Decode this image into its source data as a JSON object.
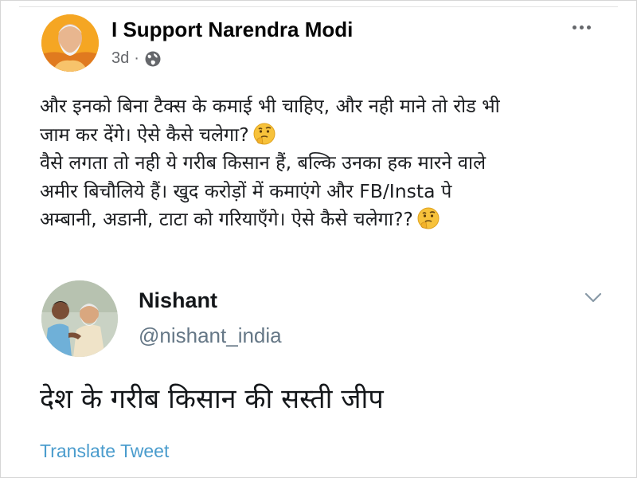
{
  "post": {
    "author": "I Support Narendra Modi",
    "time": "3d",
    "separator": "·",
    "lines": [
      "और इनको बिना टैक्स के कमाई भी चाहिए, और नही माने तो रोड भी",
      "जाम कर देंगे। ऐसे कैसे चलेगा?",
      "वैसे लगता तो नही ये गरीब किसान हैं, बल्कि उनका हक मारने वाले",
      "अमीर बिचौलिये हैं।  खुद करोड़ों में कमाएंगे और FB/Insta पे",
      "अम्बानी, अडानी, टाटा को गरियाएँगे। ऐसे कैसे चलेगा??"
    ],
    "icons": {
      "privacy": "globe-icon",
      "menu": "more-options-icon",
      "emoji": "thinking-face-emoji"
    }
  },
  "tweet": {
    "name": "Nishant",
    "handle": "@nishant_india",
    "text": "देश के गरीब किसान की सस्ती जीप",
    "translate_label": "Translate Tweet",
    "icons": {
      "menu": "chevron-down-icon"
    }
  }
}
